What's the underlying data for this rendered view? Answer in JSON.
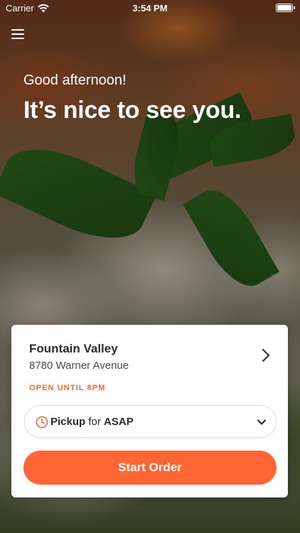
{
  "status_bar": {
    "carrier": "Carrier",
    "time": "3:54 PM",
    "wifi_icon": "wifi-icon",
    "battery_icon": "battery-icon"
  },
  "header": {
    "menu_icon": "hamburger-menu-icon"
  },
  "hero": {
    "greeting": "Good afternoon!",
    "headline": "It’s nice to see you."
  },
  "location_card": {
    "name": "Fountain Valley",
    "address": "8780 Warner Avenue",
    "hours": "OPEN UNTIL 8PM",
    "chevron_icon": "chevron-right-icon",
    "order_type": {
      "mode": "Pickup",
      "connector": "for",
      "time": "ASAP",
      "clock_icon": "clock-icon",
      "dropdown_icon": "chevron-down-icon"
    },
    "start_button": "Start Order"
  },
  "colors": {
    "accent": "#ff6633",
    "hours_text": "#f26a35",
    "card_background": "#ffffff",
    "text_dark": "#2b2b2b"
  }
}
